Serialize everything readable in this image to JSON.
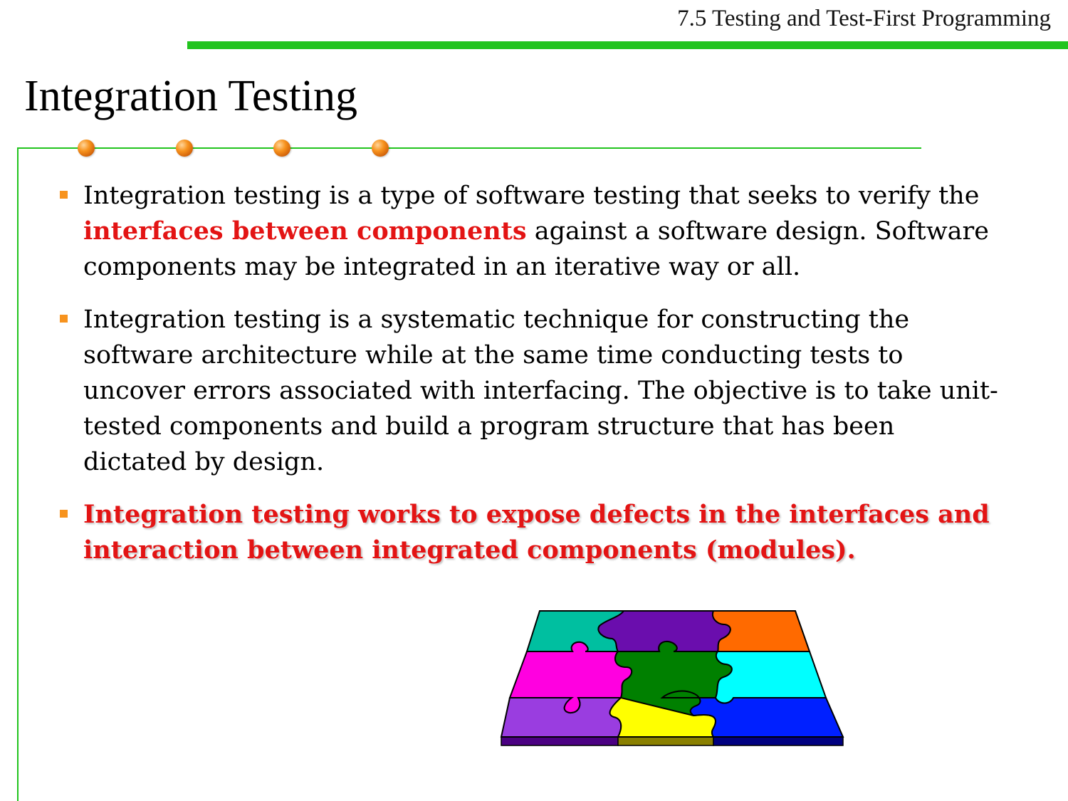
{
  "header": {
    "section_title": "7.5 Testing and Test-First Programming"
  },
  "slide": {
    "title": "Integration Testing"
  },
  "bullets": [
    {
      "pre": "Integration testing is a type of software testing that seeks to verify the ",
      "highlight": "interfaces between components",
      "post": " against a software design. Software components may be integrated in an iterative way or all."
    },
    {
      "text": "Integration testing is a systematic technique for constructing the software architecture while at the same time conducting tests to uncover errors associated with interfacing. The objective is to take unit-tested components and build a program structure that has been dictated by design."
    },
    {
      "text": "Integration testing works to expose defects in the interfaces and interaction between integrated components (modules)."
    }
  ],
  "colors": {
    "accent_green": "#22c41e",
    "bullet_orange": "#f7931e",
    "emphasis_red": "#e31414"
  },
  "illustration": {
    "icon": "puzzle-icon",
    "piece_colors": [
      "#00bfa0",
      "#6a0dad",
      "#ff6a00",
      "#ff00e0",
      "#008000",
      "#00ffff",
      "#9a3de0",
      "#ffff00",
      "#0020ff"
    ]
  }
}
